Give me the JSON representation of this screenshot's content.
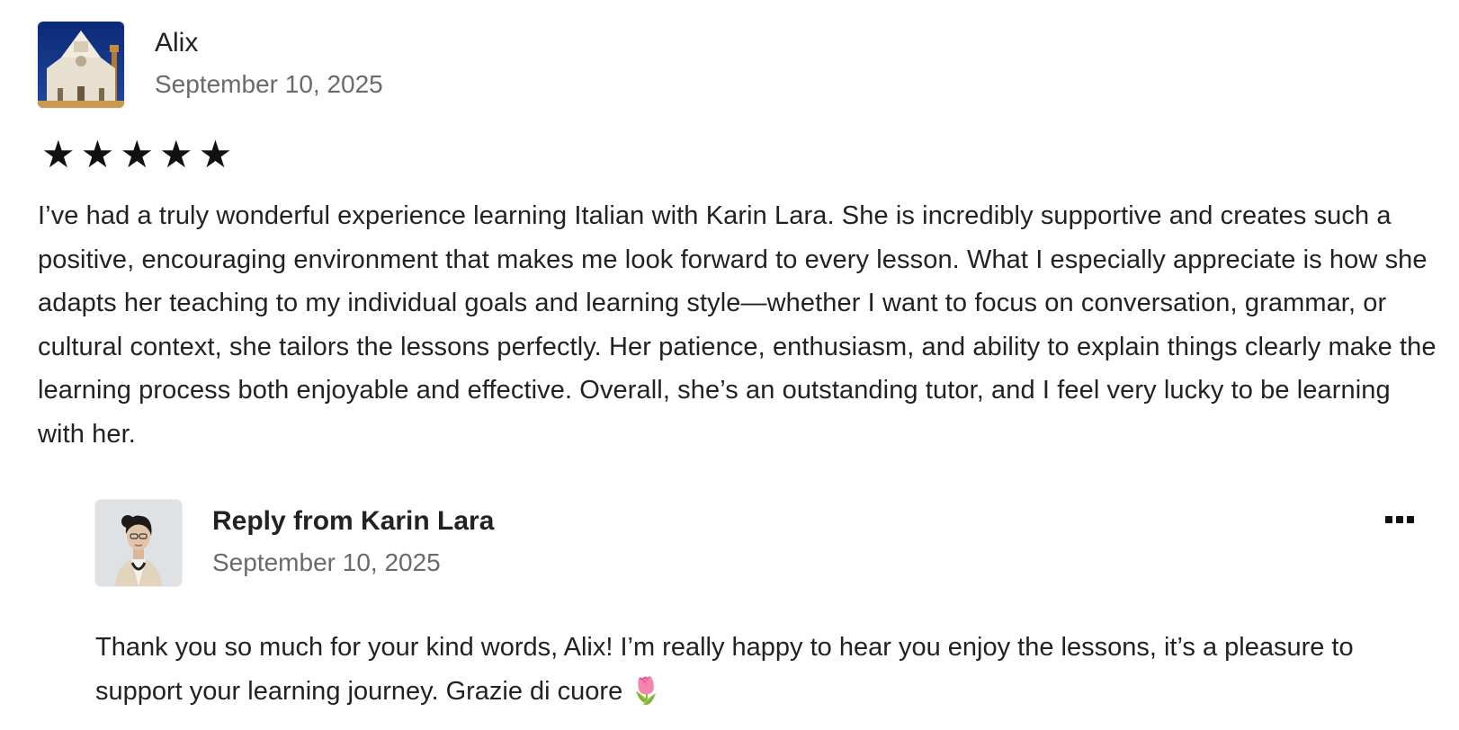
{
  "review": {
    "author": "Alix",
    "date": "September 10, 2025",
    "rating": 5,
    "rating_max": 5,
    "stars": [
      "★",
      "★",
      "★",
      "★",
      "★"
    ],
    "text": "I’ve had a truly wonderful experience learning Italian with Karin Lara. She is incredibly supportive and creates such a positive, encouraging environment that makes me look forward to every lesson. What I especially appreciate is how she adapts her teaching to my individual goals and learning style—whether I want to focus on conversation, grammar, or cultural context, she tailors the lessons perfectly. Her patience, enthusiasm, and ability to explain things clearly make the learning process both enjoyable and effective. Overall, she’s an outstanding tutor, and I feel very lucky to be learning with her."
  },
  "reply": {
    "title": "Reply from Karin Lara",
    "date": "September 10, 2025",
    "text": "Thank you so much for your kind words, Alix! I’m really happy to hear you enjoy the lessons, it’s a pleasure to support your learning journey. Grazie di cuore 🌷",
    "more_icon": "more-options-icon"
  },
  "colors": {
    "text_primary": "#222222",
    "text_secondary": "#6a6a6a",
    "star": "#111111"
  }
}
